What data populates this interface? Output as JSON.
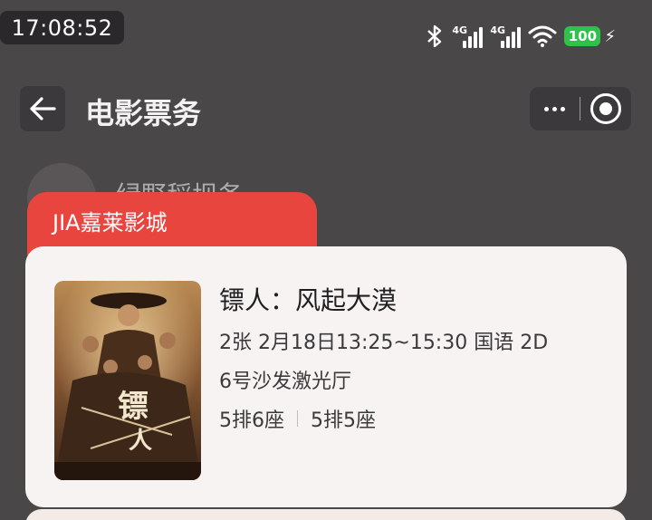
{
  "status_bar": {
    "time": "17:08:52",
    "time_ghost": "17:08",
    "network1": "4G",
    "network2": "4G",
    "battery": "100",
    "icons": [
      "bluetooth-icon",
      "signal-icon",
      "signal-icon",
      "wifi-icon",
      "battery-icon",
      "charging-icon"
    ],
    "battery_color": "#2ec24a"
  },
  "header": {
    "title": "电影票务"
  },
  "background": {
    "name_partial": "绿野稻坝务"
  },
  "order": {
    "cinema": "JIA嘉莱影城",
    "movie_title": "镖人：风起大漠",
    "show_info": "2张 2月18日13:25~15:30 国语 2D",
    "hall": "6号沙发激光厅",
    "seats": [
      "5排6座",
      "5排5座"
    ],
    "accent_color": "#e9453f"
  }
}
